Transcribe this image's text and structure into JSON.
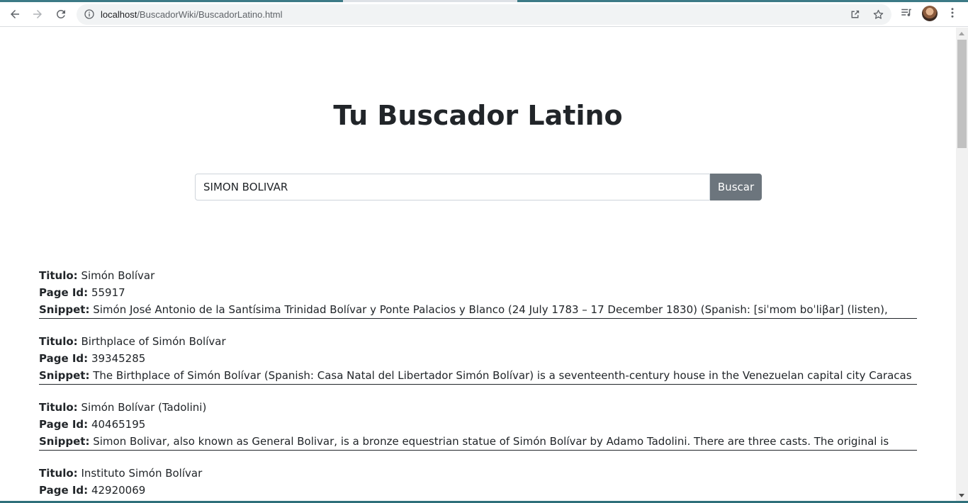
{
  "browser": {
    "url_host": "localhost",
    "url_path": "/BuscadorWiki/BuscadorLatino.html"
  },
  "page": {
    "title": "Tu Buscador Latino",
    "search": {
      "value": "SIMON BOLIVAR",
      "button_label": "Buscar"
    },
    "labels": {
      "titulo": "Titulo:",
      "page_id": "Page Id:",
      "snippet": "Snippet:"
    },
    "results": [
      {
        "titulo": "Simón Bolívar",
        "page_id": "55917",
        "snippet": "Simón José Antonio de la Santísima Trinidad Bolívar y Ponte Palacios y Blanco (24 July 1783 – 17 December 1830) (Spanish: [siˈmom boˈliβar] (listen),"
      },
      {
        "titulo": "Birthplace of Simón Bolívar",
        "page_id": "39345285",
        "snippet": "The Birthplace of Simón Bolívar (Spanish: Casa Natal del Libertador Simón Bolívar) is a seventeenth-century house in the Venezuelan capital city Caracas"
      },
      {
        "titulo": "Simón Bolívar (Tadolini)",
        "page_id": "40465195",
        "snippet": "Simon Bolivar, also known as General Bolivar, is a bronze equestrian statue of Simón Bolívar by Adamo Tadolini. There are three casts. The original is"
      },
      {
        "titulo": "Instituto Simón Bolívar",
        "page_id": "42920069",
        "snippet": ""
      }
    ]
  },
  "icons": {
    "back": "arrow-left-icon",
    "forward": "arrow-right-icon",
    "reload": "reload-icon",
    "info": "info-icon",
    "share": "share-icon",
    "bookmark": "star-icon",
    "media": "media-queue-icon",
    "menu": "kebab-menu-icon"
  }
}
